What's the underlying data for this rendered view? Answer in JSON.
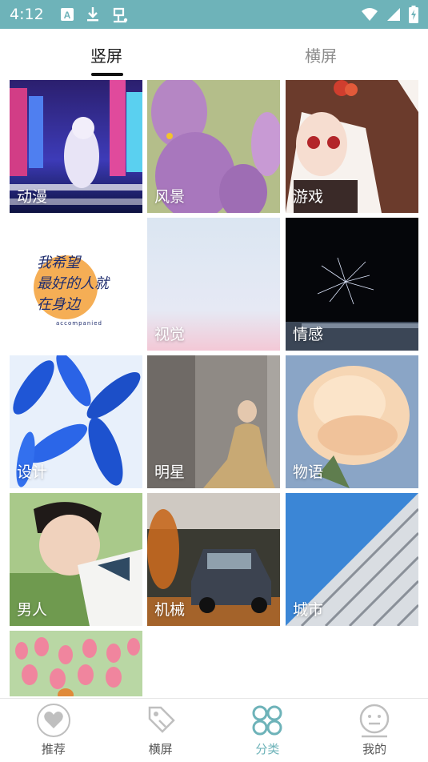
{
  "status_bar": {
    "time": "4:12",
    "left_icons": [
      "a-notification-icon",
      "download-icon",
      "bug-icon"
    ],
    "right_icons": [
      "wifi-icon",
      "signal-icon",
      "battery-charging-icon"
    ],
    "bar_color": "#6eb3b9"
  },
  "tabs": [
    {
      "label": "竖屏",
      "active": true
    },
    {
      "label": "横屏",
      "active": false
    }
  ],
  "categories": [
    {
      "label": "动漫"
    },
    {
      "label": "风景"
    },
    {
      "label": "游戏"
    },
    {
      "label": "",
      "artwork_text": "我希望\n最好的人就\n在身边",
      "artwork_caption": "accompanied"
    },
    {
      "label": "视觉"
    },
    {
      "label": "情感"
    },
    {
      "label": "设计"
    },
    {
      "label": "明星"
    },
    {
      "label": "物语"
    },
    {
      "label": "男人"
    },
    {
      "label": "机械"
    },
    {
      "label": "城市"
    },
    {
      "label": ""
    }
  ],
  "bottom_nav": [
    {
      "label": "推荐",
      "icon": "heart-icon",
      "active": false
    },
    {
      "label": "横屏",
      "icon": "tag-icon",
      "active": false
    },
    {
      "label": "分类",
      "icon": "category-grid-icon",
      "active": true
    },
    {
      "label": "我的",
      "icon": "smiley-profile-icon",
      "active": false
    }
  ],
  "colors": {
    "accent": "#6eb3b9",
    "tab_active": "#1a1a1a",
    "tab_inactive": "#8d8d8d"
  }
}
